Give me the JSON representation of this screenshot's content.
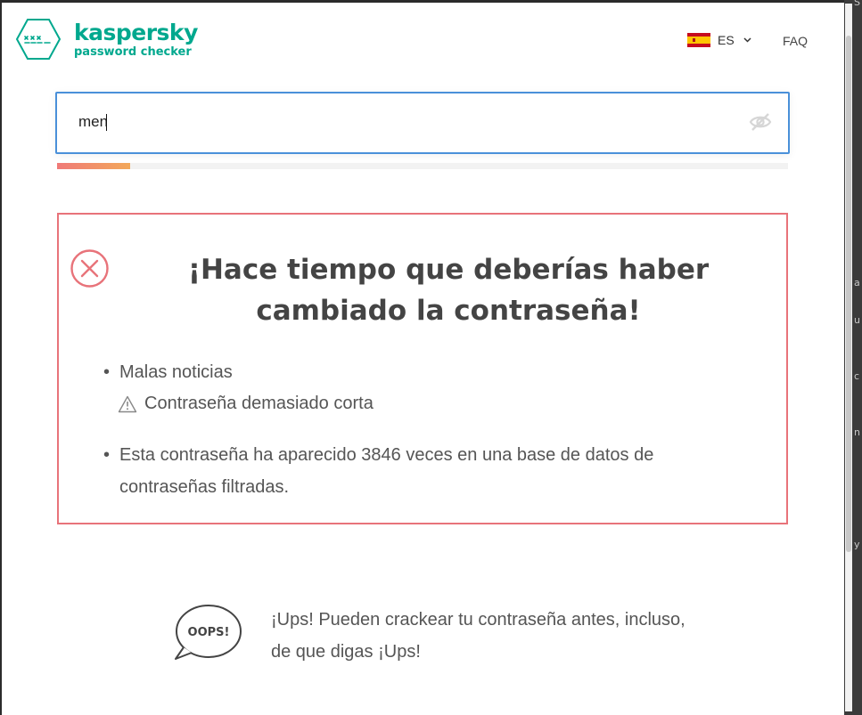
{
  "header": {
    "brand_name": "kaspersky",
    "brand_sub": "password checker",
    "language_code": "ES",
    "language_flag": "spain-flag",
    "faq_label": "FAQ"
  },
  "password_field": {
    "value": "men",
    "visibility_icon": "eye-off-icon"
  },
  "strength_meter": {
    "level": 0.1,
    "color_start": "#f07a78",
    "color_end": "#f2a85a"
  },
  "result": {
    "icon": "error-x-circle-icon",
    "title": "¡Hace tiempo que deberías haber cambiado la contraseña!",
    "bullets": [
      {
        "text": "Malas noticias",
        "warning": "Contraseña demasiado corta"
      },
      {
        "text": "Esta contraseña ha aparecido 3846 veces en una base de datos de contraseñas filtradas."
      }
    ],
    "border_color": "#e8737a"
  },
  "tip": {
    "icon_label": "OOPS!",
    "text": "¡Ups! Pueden crackear tu contraseña antes, incluso, de que digas ¡Ups!"
  },
  "side_letters": [
    "S",
    "a",
    "u",
    "c",
    "n",
    "y"
  ],
  "colors": {
    "brand": "#00a88e",
    "focus": "#4a90d9",
    "alert": "#e8737a"
  }
}
